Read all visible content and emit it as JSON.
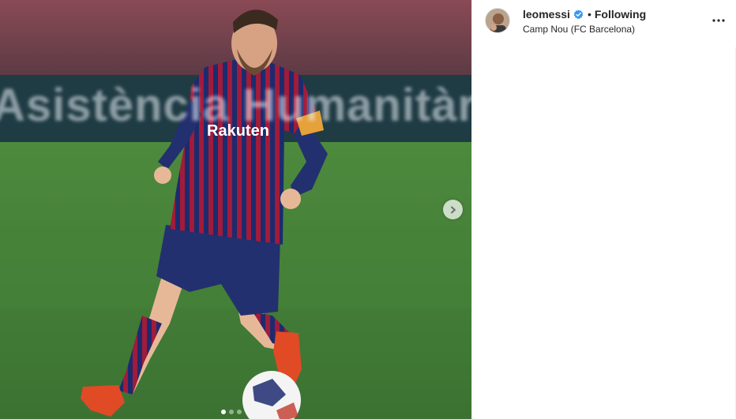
{
  "post": {
    "media": {
      "background_ad_text": "Asistència Humanitària",
      "next_icon": "chevron-right-icon",
      "carousel": {
        "total": 3,
        "active": 1
      }
    },
    "header": {
      "username": "leomessi",
      "verified_icon": "verified-badge-icon",
      "separator": "•",
      "follow_status": "Following",
      "location": "Camp Nou (FC Barcelona)",
      "more_icon": "more-options-icon"
    },
    "colors": {
      "verified_blue": "#3897f0",
      "text": "#262626",
      "pitch_green": "#3f7a34",
      "kit_blue": "#1d2b6e",
      "kit_garnet": "#a11b3b"
    }
  }
}
